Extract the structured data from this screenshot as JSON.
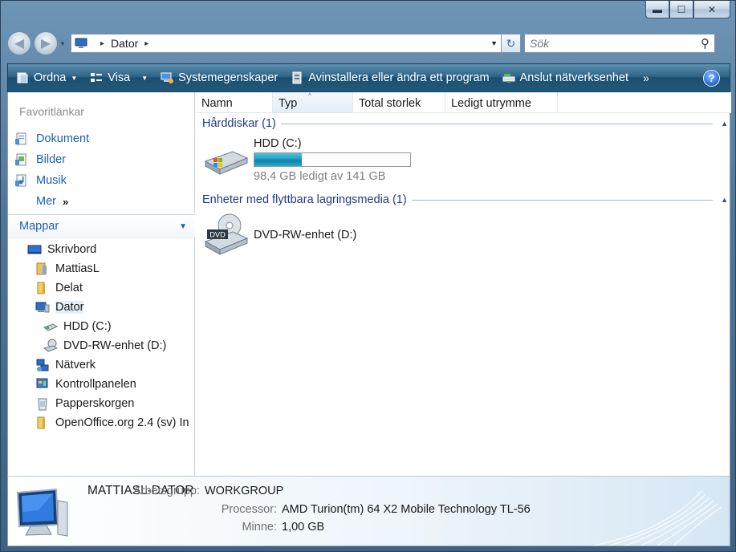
{
  "window": {
    "minimize_glyph": "▬",
    "maximize_glyph": "☐",
    "close_glyph": "✕"
  },
  "address_bar": {
    "back_glyph": "◀",
    "forward_glyph": "▶",
    "path": "Dator",
    "separator_glyph": "▸",
    "refresh_glyph": "↻",
    "search_placeholder": "Sök",
    "search_value": ""
  },
  "command_bar": {
    "items": [
      {
        "label": "Ordna",
        "icon": "organize-icon",
        "dropdown": true
      },
      {
        "label": "Visa",
        "icon": "views-icon",
        "dropdown": true
      },
      {
        "label": "Systemegenskaper",
        "icon": "system-properties-icon",
        "dropdown": false
      },
      {
        "label": "Avinstallera eller ändra ett program",
        "icon": "uninstall-program-icon",
        "dropdown": false
      },
      {
        "label": "Anslut nätverksenhet",
        "icon": "map-network-drive-icon",
        "dropdown": false
      }
    ],
    "more_glyph": "»",
    "help_glyph": "?"
  },
  "nav_pane": {
    "favorites_title": "Favoritlänkar",
    "favorites": [
      {
        "label": "Dokument",
        "icon": "documents-icon"
      },
      {
        "label": "Bilder",
        "icon": "pictures-icon"
      },
      {
        "label": "Musik",
        "icon": "music-icon"
      }
    ],
    "more_label": "Mer",
    "more_glyph": "»",
    "folders_title": "Mappar",
    "folders_chevron": "⌄",
    "tree": [
      {
        "label": "Skrivbord",
        "icon": "desktop-icon",
        "level": 0
      },
      {
        "label": "MattiasL",
        "icon": "user-folder-icon",
        "level": 1
      },
      {
        "label": "Delat",
        "icon": "folder-icon",
        "level": 1
      },
      {
        "label": "Dator",
        "icon": "computer-icon",
        "level": 1,
        "selected": true
      },
      {
        "label": "HDD (C:)",
        "icon": "hard-drive-icon",
        "level": 2
      },
      {
        "label": "DVD-RW-enhet (D:)",
        "icon": "dvd-drive-icon",
        "level": 2
      },
      {
        "label": "Nätverk",
        "icon": "network-icon",
        "level": 1
      },
      {
        "label": "Kontrollpanelen",
        "icon": "control-panel-icon",
        "level": 1
      },
      {
        "label": "Papperskorgen",
        "icon": "recycle-bin-icon",
        "level": 1
      },
      {
        "label": "OpenOffice.org 2.4 (sv) In",
        "icon": "folder-icon",
        "level": 1
      }
    ]
  },
  "main_pane": {
    "columns": [
      "Namn",
      "Typ",
      "Total storlek",
      "Ledigt utrymme"
    ],
    "sort_glyph": "^",
    "groups": [
      {
        "title": "Hårddiskar (1)",
        "collapse_glyph": "⌃",
        "items": [
          {
            "name": "HDD (C:)",
            "free_text": "98,4 GB ledigt av 141 GB",
            "used_fraction": 0.302
          }
        ]
      },
      {
        "title": "Enheter med flyttbara lagringsmedia (1)",
        "collapse_glyph": "⌃",
        "items": [
          {
            "name": "DVD-RW-enhet (D:)",
            "badge": "DVD"
          }
        ]
      }
    ]
  },
  "details": {
    "computer_name": "MATTIASL-DATOR",
    "rows": [
      {
        "key": "Arbetsgrupp:",
        "value": "WORKGROUP"
      },
      {
        "key": "Processor:",
        "value": "AMD Turion(tm) 64 X2 Mobile Technology TL-56"
      },
      {
        "key": "Minne:",
        "value": "1,00 GB"
      }
    ]
  },
  "colors": {
    "link_blue": "#1b5fb4",
    "group_blue": "#1e3b8a",
    "command_bar": "#21597a",
    "bar_fill": "#1f9ec2"
  }
}
